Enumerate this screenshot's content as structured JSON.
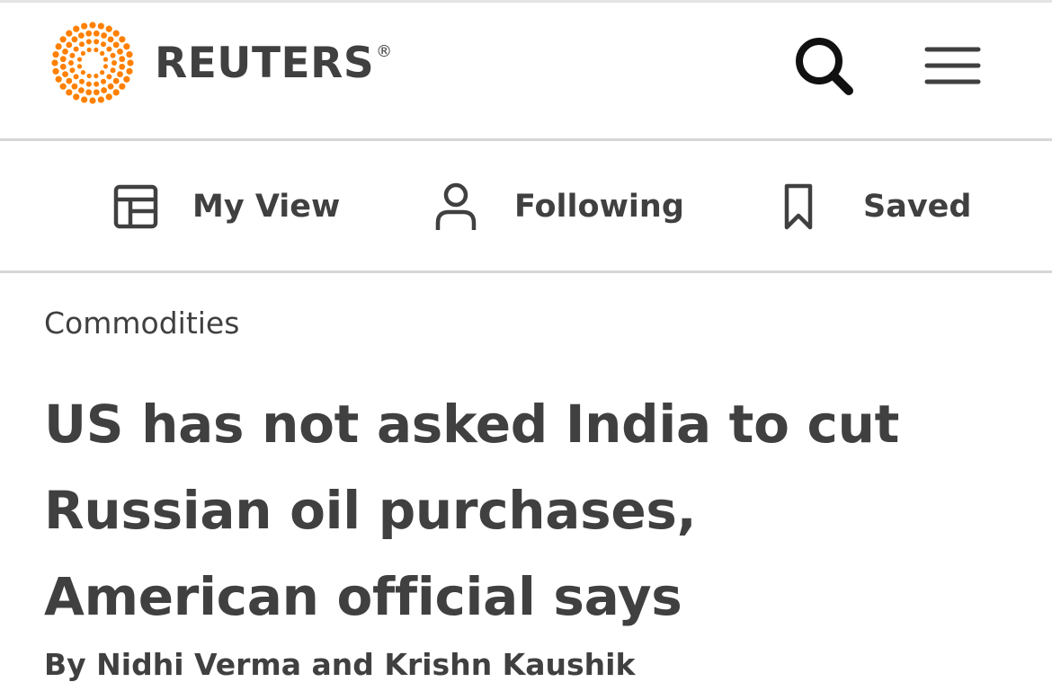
{
  "header": {
    "brand_name": "REUTERS",
    "registered_mark": "®",
    "logo_icon": "reuters-dot-ring-logo",
    "search_icon": "search-icon",
    "menu_icon": "hamburger-menu-icon",
    "brand_color": "#ff8000"
  },
  "nav": {
    "items": [
      {
        "label": "My View",
        "icon": "layout-icon"
      },
      {
        "label": "Following",
        "icon": "person-icon"
      },
      {
        "label": "Saved",
        "icon": "bookmark-icon"
      }
    ]
  },
  "article": {
    "section": "Commodities",
    "headline": "US has not asked India to cut Russian oil purchases, American official says",
    "byline": "By Nidhi Verma and Krishn Kaushik"
  },
  "colors": {
    "text": "#404040",
    "divider": "#d6d6d6",
    "background": "#ffffff",
    "accent": "#ff8000"
  }
}
